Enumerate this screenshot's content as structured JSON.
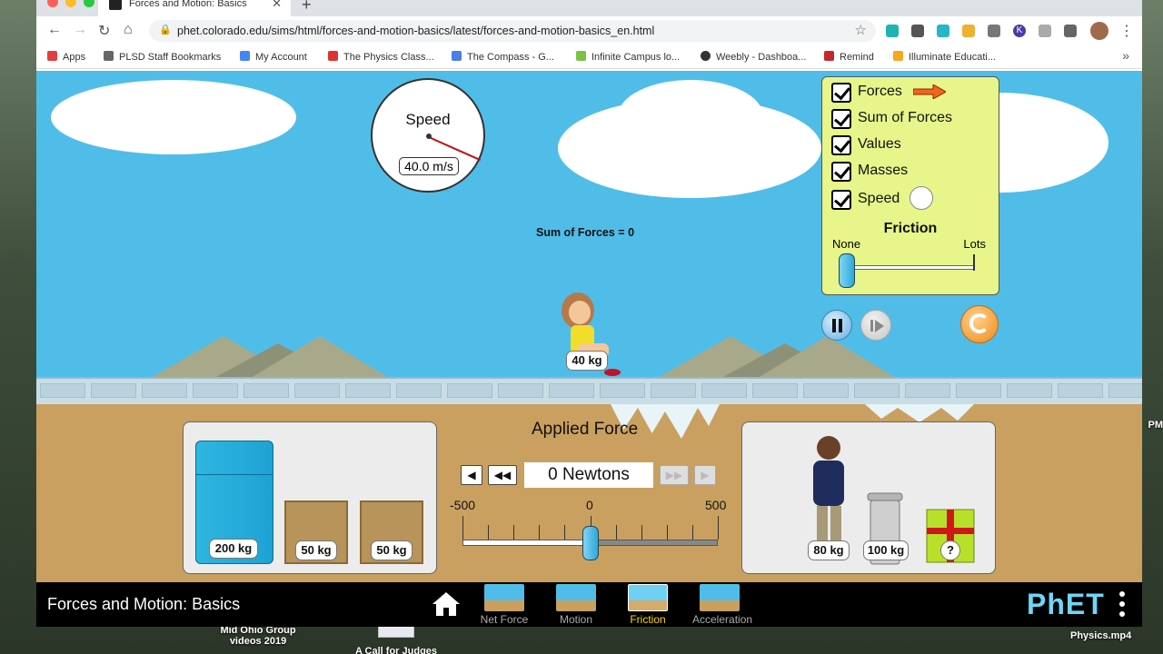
{
  "browser": {
    "tab_title": "Forces and Motion: Basics",
    "url": "phet.colorado.edu/sims/html/forces-and-motion-basics/latest/forces-and-motion-basics_en.html",
    "bookmarks": [
      "Apps",
      "PLSD Staff Bookmarks",
      "My Account",
      "The Physics Class...",
      "The Compass - G...",
      "Infinite Campus lo...",
      "Weebly - Dashboa...",
      "Remind",
      "Illuminate Educati..."
    ]
  },
  "desktop": {
    "item1": "Mid Ohio Group\nvideos 2019",
    "item2": "A Call for Judges",
    "clock": "PM",
    "video": "Physics.mp4"
  },
  "sim": {
    "speedometer": {
      "label": "Speed",
      "value": "40.0 m/s"
    },
    "sum_of_forces": "Sum of Forces = 0",
    "controls": {
      "forces": "Forces",
      "sum_of_forces": "Sum of Forces",
      "values": "Values",
      "masses": "Masses",
      "speed": "Speed",
      "friction_title": "Friction",
      "friction_none": "None",
      "friction_lots": "Lots",
      "friction_level": 0
    },
    "girl_mass": "40 kg",
    "left_panel": {
      "fridge": "200 kg",
      "crate1": "50 kg",
      "crate2": "50 kg"
    },
    "right_panel": {
      "man": "80 kg",
      "trash": "100 kg",
      "gift": "?"
    },
    "applied_force": {
      "title": "Applied Force",
      "readout": "0 Newtons",
      "min": "-500",
      "mid": "0",
      "max": "500",
      "value": 0
    },
    "nav": {
      "title": "Forces and Motion: Basics",
      "tabs": [
        "Net Force",
        "Motion",
        "Friction",
        "Acceleration"
      ],
      "active_tab": "Friction",
      "logo": "PhET"
    }
  },
  "colors": {
    "sky": "#50bde8",
    "ground": "#c9a060",
    "control_panel": "#e7f58a",
    "active_tab": "#ffd600"
  }
}
